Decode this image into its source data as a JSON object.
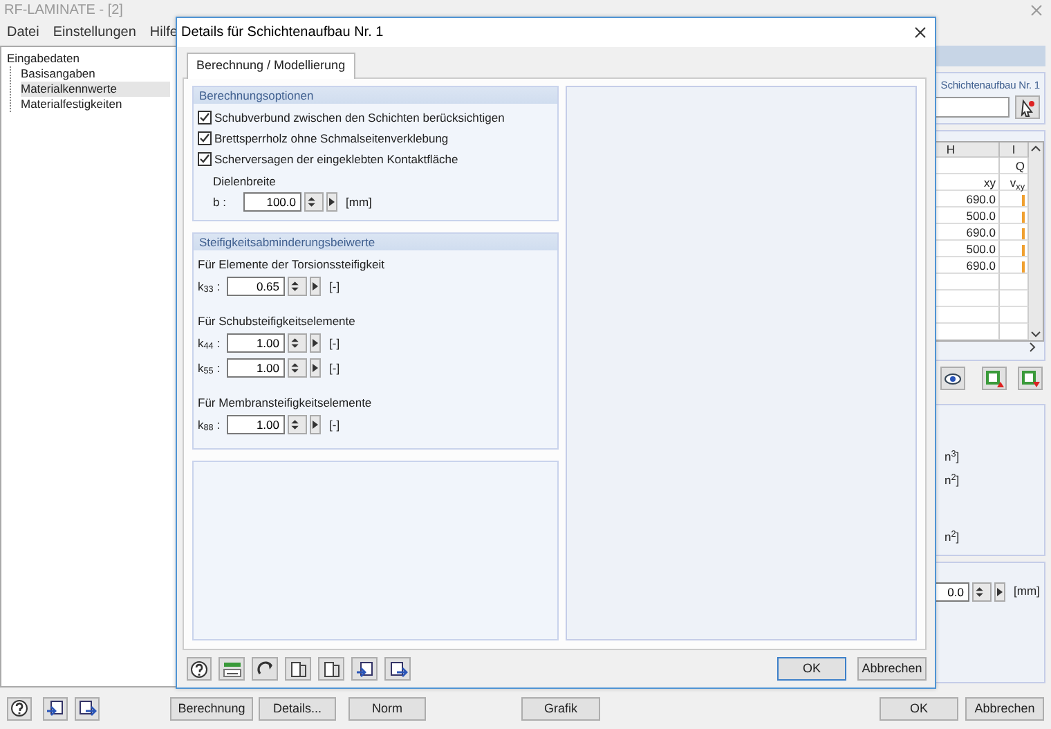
{
  "main": {
    "title": "RF-LAMINATE - [2]",
    "menu": [
      "Datei",
      "Einstellungen",
      "Hilfe"
    ],
    "tree": [
      {
        "label": "Eingabedaten",
        "children": [
          {
            "label": "Basisangaben",
            "selected": false
          },
          {
            "label": "Materialkennwerte",
            "selected": true
          },
          {
            "label": "Materialfestigkeiten",
            "selected": false
          }
        ]
      }
    ],
    "layer_label": "Schichtenaufbau Nr. 1",
    "table": {
      "columns": [
        {
          "header": "H",
          "unit": "xy"
        },
        {
          "header": "I",
          "subheader": "Q",
          "unit": "v$_{xy}$"
        }
      ],
      "rows": [
        "690.0",
        "500.0",
        "690.0",
        "500.0",
        "690.0"
      ]
    },
    "units": [
      "n$^{3}$]",
      "n$^{2}$]",
      "n$^{2}$]"
    ],
    "offset": {
      "value": "0.0",
      "unit": "[mm]"
    },
    "left_buttons": [
      "Berechnung",
      "Details...",
      "Norm"
    ],
    "center_buttons": [
      "Grafik"
    ],
    "right_buttons": [
      "OK",
      "Abbrechen"
    ]
  },
  "dialog": {
    "title": "Details für Schichtenaufbau Nr. 1",
    "tabs": [
      {
        "label": "Berechnung / Modellierung",
        "selected": true
      }
    ],
    "options_group": {
      "title": "Berechnungsoptionen",
      "options": [
        {
          "label": "Schubverbund zwischen den Schichten berücksichtigen",
          "checked": true
        },
        {
          "label": "Brettsperrholz ohne Schmalseitenverklebung",
          "checked": true
        },
        {
          "label": "Scherversagen der eingeklebten Kontaktfläche",
          "checked": true
        }
      ],
      "field_heading": "Dielenbreite",
      "field": {
        "label": "b :",
        "value": "100.0",
        "unit": "[mm]"
      }
    },
    "stiffness_group": {
      "title": "Steifigkeitsabminderungsbeiwerte",
      "sections": [
        {
          "heading": "Für Elemente der Torsionssteifigkeit",
          "fields": [
            {
              "label": "k$_{33}$ :",
              "value": "0.65",
              "unit": "[-]"
            }
          ]
        },
        {
          "heading": "Für Schubsteifigkeitselemente",
          "fields": [
            {
              "label": "k$_{44}$ :",
              "value": "1.00",
              "unit": "[-]"
            },
            {
              "label": "k$_{55}$ :",
              "value": "1.00",
              "unit": "[-]"
            }
          ]
        },
        {
          "heading": "Für Membransteifigkeitselemente",
          "fields": [
            {
              "label": "k$_{88}$ :",
              "value": "1.00",
              "unit": "[-]"
            }
          ]
        }
      ]
    },
    "buttons": [
      {
        "label": "OK",
        "default": true
      },
      {
        "label": "Abbrechen",
        "default": false
      }
    ]
  }
}
